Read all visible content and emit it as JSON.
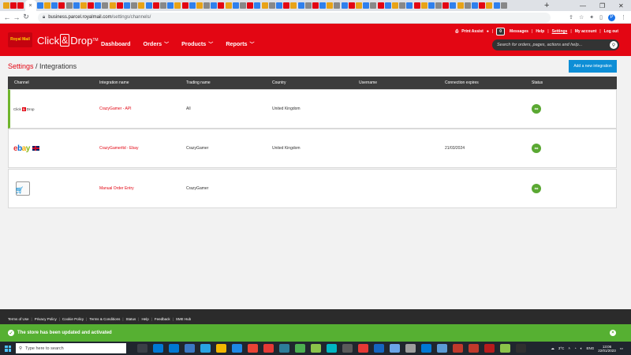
{
  "browser": {
    "tab_favicon_colors": [
      "#e8a317",
      "#e30613",
      "#e30613",
      "#2f80ed",
      "#e8a317",
      "#2f80ed",
      "#e30613",
      "#888888",
      "#2f80ed",
      "#e8a317",
      "#e30613",
      "#2f80ed",
      "#888888",
      "#e8a317",
      "#e30613",
      "#2f80ed",
      "#888888",
      "#e8a317",
      "#2f80ed",
      "#e30613",
      "#888888",
      "#2f80ed",
      "#e8a317",
      "#e30613",
      "#2f80ed",
      "#e8a317",
      "#888888",
      "#2f80ed",
      "#e30613",
      "#e8a317",
      "#2f80ed",
      "#888888",
      "#e30613",
      "#2f80ed",
      "#e8a317",
      "#888888",
      "#2f80ed",
      "#e30613",
      "#e8a317",
      "#2f80ed",
      "#888888",
      "#e30613",
      "#2f80ed",
      "#e8a317",
      "#888888",
      "#2f80ed",
      "#e30613",
      "#e8a317",
      "#2f80ed",
      "#888888",
      "#e30613",
      "#2f80ed",
      "#e8a317",
      "#888888",
      "#2f80ed",
      "#e30613",
      "#e8a317",
      "#2f80ed",
      "#888888",
      "#e30613",
      "#2f80ed",
      "#e8a317",
      "#888888",
      "#2f80ed",
      "#e30613",
      "#e8a317",
      "#2f80ed",
      "#888888"
    ],
    "url_host": "business.parcel.royalmail.com",
    "url_path": "/settings/channels/",
    "profile_initial": "P"
  },
  "header": {
    "logo_text": "Royal Mail",
    "brand_left": "Click",
    "brand_amp": "&",
    "brand_right": "Drop",
    "brand_tm": "TM",
    "nav": [
      {
        "label": "Dashboard"
      },
      {
        "label": "Orders"
      },
      {
        "label": "Products"
      },
      {
        "label": "Reports"
      }
    ],
    "print_assist": "Print Assist",
    "messages_count": "0",
    "messages": "Messages",
    "help": "Help",
    "settings": "Settings",
    "my_account": "My account",
    "log_out": "Log out",
    "search_placeholder": "Search for orders, pages, actions and help..."
  },
  "page": {
    "title_crumb": "Settings",
    "title_sep": " / ",
    "title_current": "Integrations",
    "add_button": "Add a new integration"
  },
  "table": {
    "columns": [
      "Channel",
      "Integration name",
      "Trading name",
      "Country",
      "Username",
      "Connection expires",
      "Status"
    ],
    "rows": [
      {
        "channel": "Click & Drop",
        "name": "CrazyGamer - API",
        "trading": "All",
        "country": "United Kingdom",
        "username": "",
        "expires": ""
      },
      {
        "channel": "eBay",
        "name": "CrazyGamerltd - Ebay",
        "trading": "CrazyGamer",
        "country": "United Kingdom",
        "username": "",
        "expires": "21/03/2024"
      },
      {
        "channel": "Manual",
        "name": "Manual Order Entry",
        "trading": "CrazyGamer",
        "country": "",
        "username": "",
        "expires": ""
      }
    ]
  },
  "footer": {
    "links": [
      "Terms of Use",
      "Privacy Policy",
      "Cookie Policy",
      "Terms & Conditions",
      "Status",
      "Help",
      "Feedback",
      "SME Hub"
    ]
  },
  "toast": {
    "message": "The store has been updated and activated"
  },
  "taskbar": {
    "search_placeholder": "Type here to search",
    "app_colors": [
      "#3a3f47",
      "#0078d4",
      "#0078d4",
      "#3b78c4",
      "#29a3e3",
      "#f3b700",
      "#1e88e5",
      "#ea4335",
      "#e53935",
      "#2d7d9a",
      "#4caf50",
      "#8bc34a",
      "#00b7c3",
      "#5a5a5a",
      "#e53935",
      "#1565c0",
      "#6ba4e7",
      "#9e9e9e",
      "#0078d4",
      "#5b9bd5",
      "#c0392b",
      "#c0392b",
      "#b71c1c",
      "#8bc34a",
      "#2f2f2f"
    ],
    "weather": "3°C",
    "language": "ENG",
    "time": "13:06",
    "date": "22/01/2023"
  }
}
